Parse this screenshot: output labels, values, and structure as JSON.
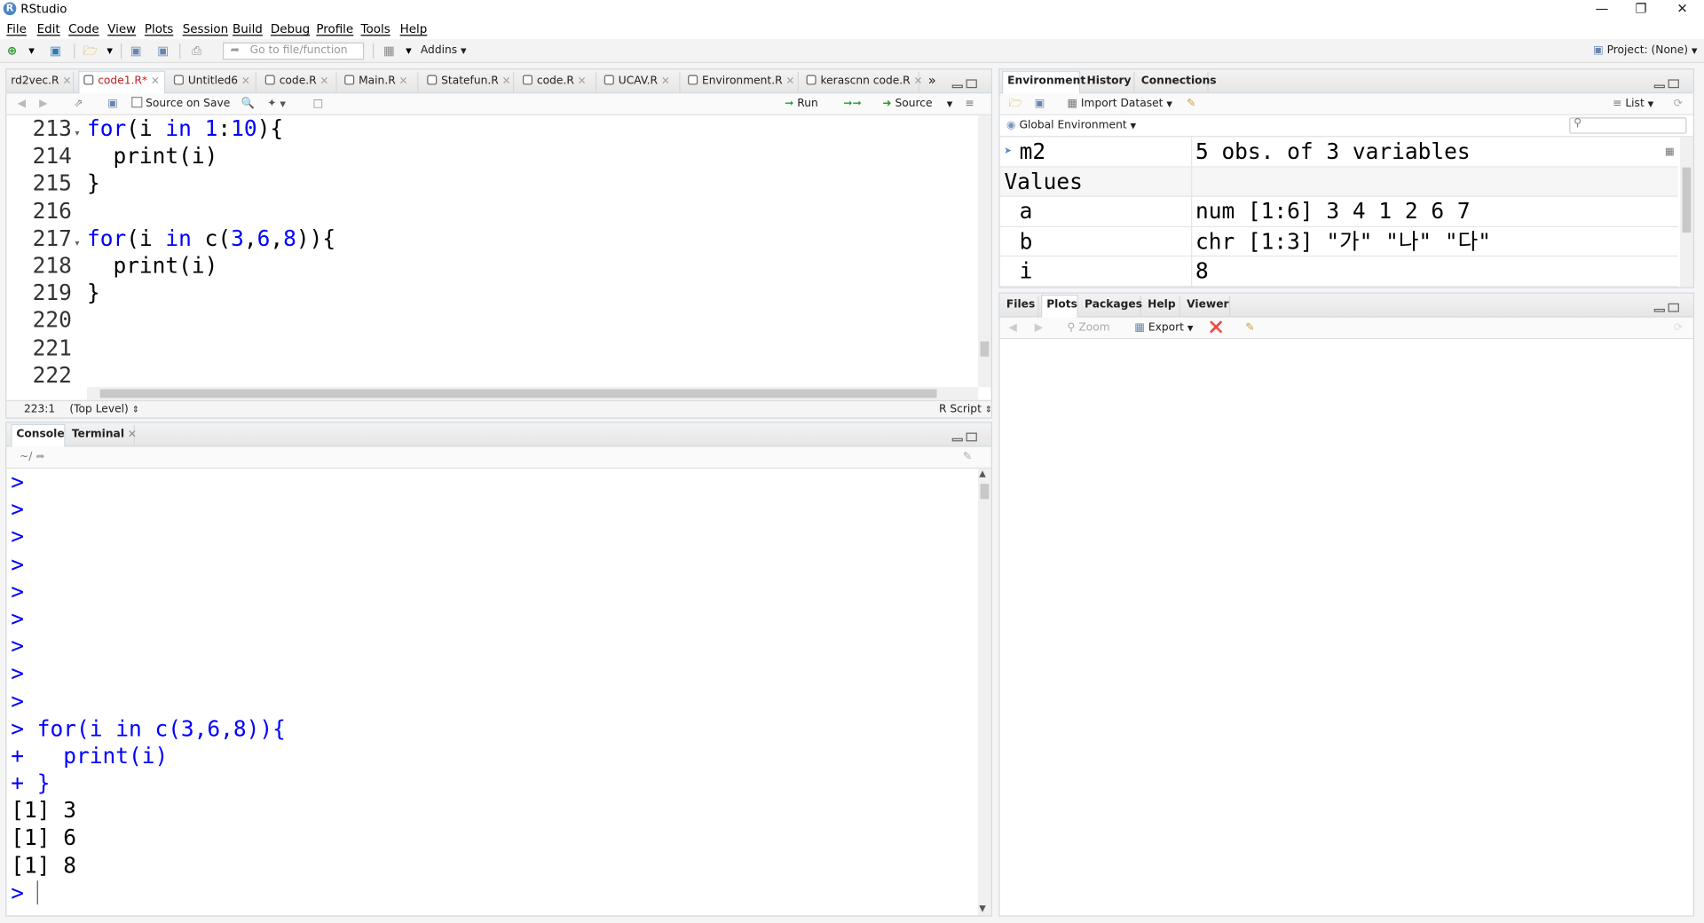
{
  "window": {
    "title": "RStudio",
    "logo": "R"
  },
  "menu": [
    "File",
    "Edit",
    "Code",
    "View",
    "Plots",
    "Session",
    "Build",
    "Debug",
    "Profile",
    "Tools",
    "Help"
  ],
  "toolbar": {
    "goto_placeholder": "Go to file/function",
    "addins": "Addins",
    "project": "Project: (None)"
  },
  "editor": {
    "tabs": [
      "rd2vec.R",
      "code1.R*",
      "Untitled6",
      "code.R",
      "Main.R",
      "Statefun.R",
      "code.R",
      "UCAV.R",
      "Environment.R",
      "kerascnn code.R"
    ],
    "active_tab": "code1.R*",
    "source_on_save": "Source on Save",
    "run": "Run",
    "source": "Source",
    "line_numbers": [
      "213",
      "214",
      "215",
      "216",
      "217",
      "218",
      "219",
      "220",
      "221",
      "222"
    ],
    "position": "223:1",
    "scope": "(Top Level)",
    "filetype": "R Script"
  },
  "console": {
    "tabs": [
      "Console",
      "Terminal"
    ],
    "path": "~/",
    "prompt_count": 9,
    "prompt": ">",
    "lines": [
      {
        "p": ">",
        "t": "for(i in c(3,6,8)){"
      },
      {
        "p": "+",
        "t": "  print(i)"
      },
      {
        "p": "+",
        "t": "}"
      }
    ],
    "output": [
      "[1] 3",
      "[1] 6",
      "[1] 8"
    ]
  },
  "environment": {
    "tabs": [
      "Environment",
      "History",
      "Connections"
    ],
    "import_dataset": "Import Dataset",
    "view_mode": "List",
    "scope": "Global Environment",
    "data_row": {
      "name": "m2",
      "value": "5 obs. of 3 variables"
    },
    "values_header": "Values",
    "values": [
      {
        "name": "a",
        "value": "num [1:6] 3 4 1 2 6 7"
      },
      {
        "name": "b",
        "value": "chr [1:3] \"가\" \"나\" \"다\""
      },
      {
        "name": "i",
        "value": "8"
      }
    ]
  },
  "files": {
    "tabs": [
      "Files",
      "Plots",
      "Packages",
      "Help",
      "Viewer"
    ],
    "active_tab": "Plots",
    "zoom": "Zoom",
    "export": "Export"
  }
}
